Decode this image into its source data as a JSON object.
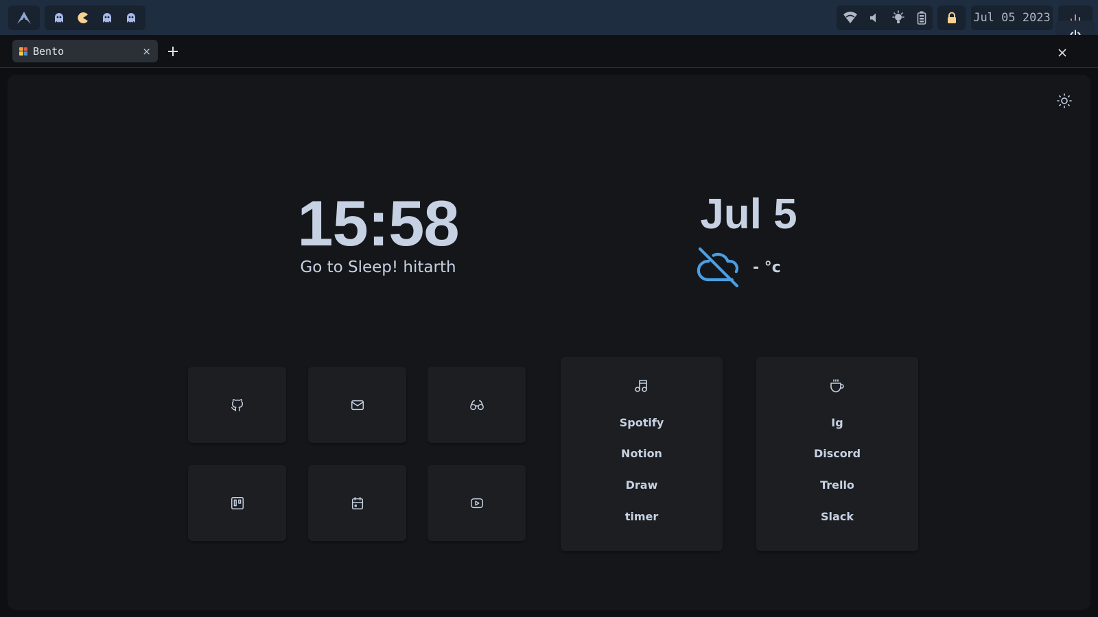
{
  "topbar": {
    "date": "Jul 05 2023",
    "workspaces": [
      "ghost-icon",
      "pacman-icon",
      "ghost-icon",
      "ghost-icon"
    ],
    "system_icons": [
      "wifi-icon",
      "volume-icon",
      "brightness-icon",
      "battery-icon"
    ],
    "colors": {
      "bar": "#1f2d40",
      "pill": "#19222f",
      "pacman": "#f5d28e",
      "ghost": "#a8b9ec",
      "accent_red": "#e8848e"
    }
  },
  "browser": {
    "tab_title": "Bento",
    "tab_close": "×",
    "new_tab": "+"
  },
  "page": {
    "time": "15:58",
    "greeting": "Go to Sleep! hitarth",
    "date": "Jul 5",
    "temperature": "- °c",
    "weather_icon": "cloud-off-icon",
    "colors": {
      "text": "#c6d2e3",
      "weather": "#4a9fe4",
      "card": "#1c1e21",
      "background": "#141619"
    }
  },
  "buttons": [
    {
      "icon": "github-icon"
    },
    {
      "icon": "mail-icon"
    },
    {
      "icon": "glasses-icon"
    },
    {
      "icon": "trello-icon"
    },
    {
      "icon": "calendar-icon"
    },
    {
      "icon": "youtube-icon"
    }
  ],
  "lists": [
    {
      "icon": "music-icon",
      "items": [
        "Spotify",
        "Notion",
        "Draw",
        "timer"
      ]
    },
    {
      "icon": "coffee-icon",
      "items": [
        "Ig",
        "Discord",
        "Trello",
        "Slack"
      ]
    }
  ]
}
